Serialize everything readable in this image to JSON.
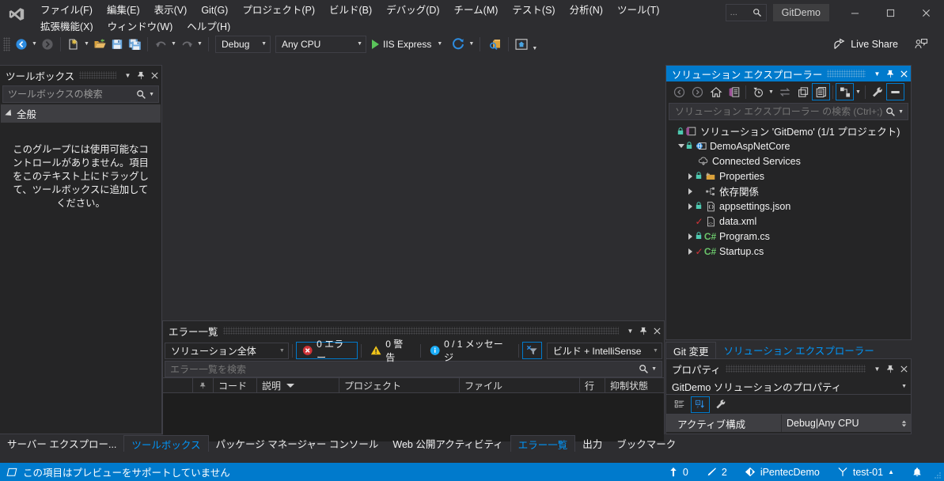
{
  "window": {
    "title": "GitDemo",
    "minimize_label": "─",
    "maximize_label": "□",
    "close_label": "✕",
    "quick_launch_placeholder": "..."
  },
  "menu": {
    "items": [
      "ファイル(F)",
      "編集(E)",
      "表示(V)",
      "Git(G)",
      "プロジェクト(P)",
      "ビルド(B)",
      "デバッグ(D)",
      "チーム(M)",
      "テスト(S)",
      "分析(N)",
      "ツール(T)",
      "拡張機能(X)",
      "ウィンドウ(W)",
      "ヘルプ(H)"
    ]
  },
  "toolbar": {
    "configuration": "Debug",
    "platform": "Any CPU",
    "run_target": "IIS Express",
    "live_share": "Live Share"
  },
  "toolbox": {
    "title": "ツールボックス",
    "search_placeholder": "ツールボックスの検索",
    "group_label": "全般",
    "empty_message": "このグループには使用可能なコントロールがありません。項目をこのテキスト上にドラッグして、ツールボックスに追加してください。"
  },
  "solution_explorer": {
    "title": "ソリューション エクスプローラー",
    "search_placeholder": "ソリューション エクスプローラー の検索 (Ctrl+;)",
    "root": "ソリューション 'GitDemo' (1/1 プロジェクト)",
    "tree": [
      {
        "label": "DemoAspNetCore",
        "icon": "web-project-icon",
        "indent": 1,
        "expander": "down",
        "lock": true,
        "check": false
      },
      {
        "label": "Connected Services",
        "icon": "connected-services-icon",
        "indent": 3,
        "expander": "none",
        "lock": false,
        "check": false
      },
      {
        "label": "Properties",
        "icon": "properties-folder-icon",
        "indent": 2,
        "expander": "right",
        "lock": true,
        "check": false
      },
      {
        "label": "依存関係",
        "icon": "dependencies-icon",
        "indent": 2,
        "expander": "right",
        "lock": false,
        "check": false
      },
      {
        "label": "appsettings.json",
        "icon": "json-file-icon",
        "indent": 2,
        "expander": "right",
        "lock": true,
        "check": false
      },
      {
        "label": "data.xml",
        "icon": "xml-file-icon",
        "indent": 3,
        "expander": "none",
        "lock": false,
        "check": true
      },
      {
        "label": "Program.cs",
        "icon": "csharp-file-icon",
        "indent": 2,
        "expander": "right",
        "lock": true,
        "check": false
      },
      {
        "label": "Startup.cs",
        "icon": "csharp-file-icon",
        "indent": 2,
        "expander": "right",
        "lock": false,
        "check": true
      }
    ]
  },
  "git_tabs": {
    "items": [
      {
        "label": "Git 変更",
        "active": true
      },
      {
        "label": "ソリューション エクスプローラー",
        "active": false
      }
    ]
  },
  "properties": {
    "title": "プロパティ",
    "object_label": "GitDemo ソリューションのプロパティ",
    "rows": [
      {
        "name": "アクティブ構成",
        "value": "Debug|Any CPU"
      }
    ]
  },
  "error_list": {
    "title": "エラー一覧",
    "scope": "ソリューション全体",
    "errors": "0 エラー",
    "warnings": "0 警告",
    "messages": "0 / 1 メッセージ",
    "source_filter": "ビルド + IntelliSense",
    "search_placeholder": "エラー一覧を検索",
    "columns": [
      "",
      "",
      "コード",
      "説明",
      "プロジェクト",
      "ファイル",
      "行",
      "抑制状態"
    ],
    "rows": []
  },
  "bottom_tabs": {
    "items": [
      {
        "label": "サーバー エクスプロー...",
        "active": false,
        "accent": false
      },
      {
        "label": "ツールボックス",
        "active": true,
        "accent": true
      },
      {
        "label": "パッケージ マネージャー コンソール",
        "active": false,
        "accent": false
      },
      {
        "label": "Web 公開アクティビティ",
        "active": false,
        "accent": false
      },
      {
        "label": "エラー一覧",
        "active": true,
        "accent": true
      },
      {
        "label": "出力",
        "active": false,
        "accent": false
      },
      {
        "label": "ブックマーク",
        "active": false,
        "accent": false
      }
    ]
  },
  "status_bar": {
    "message": "この項目はプレビューをサポートしていません",
    "outgoing_count": "0",
    "changes_count": "2",
    "repository": "iPentecDemo",
    "branch": "test-01",
    "notifications_icon": "bell-icon"
  },
  "colors": {
    "accent": "#007acc",
    "link": "#0097fb",
    "panel_bg": "#252526",
    "window_bg": "#2d2d30",
    "border": "#3f3f46",
    "error_red": "#d13438",
    "warning_yellow": "#f0c419",
    "info_blue": "#1badf8"
  }
}
